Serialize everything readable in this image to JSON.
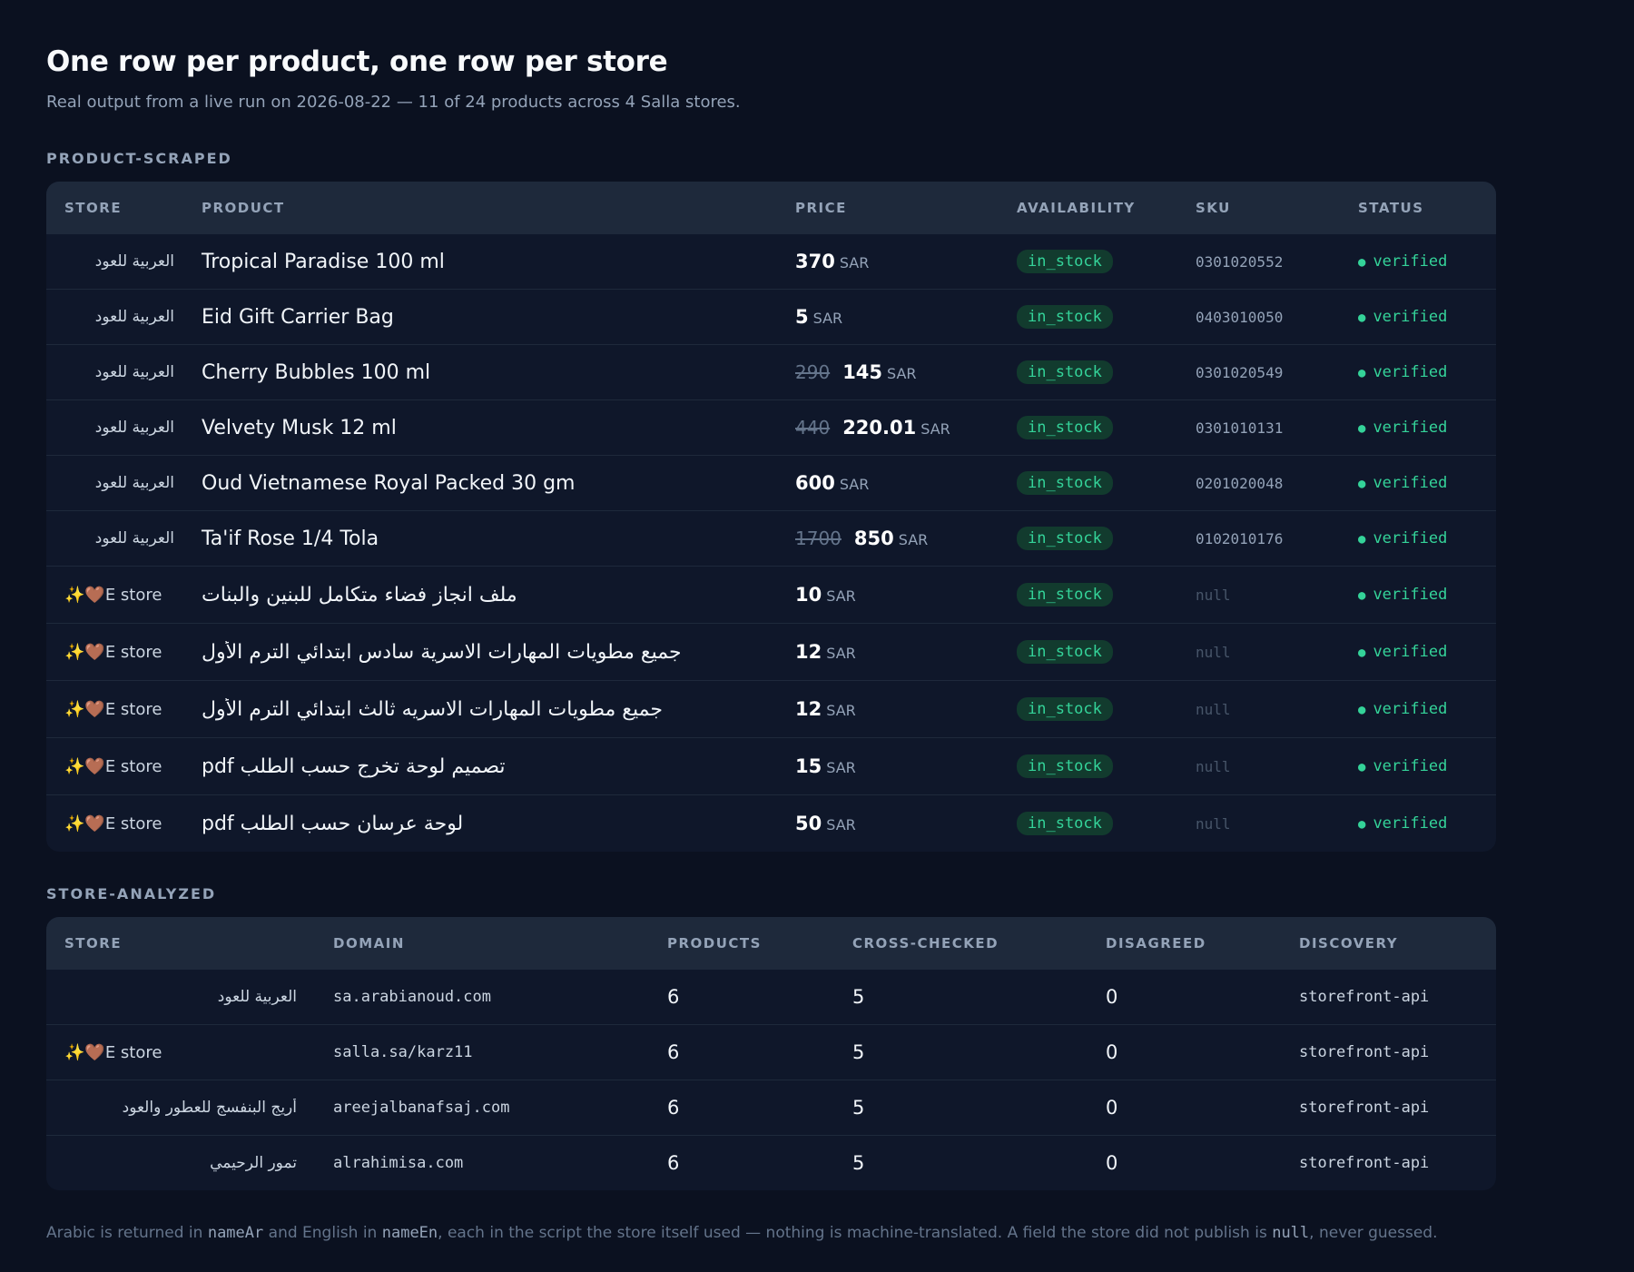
{
  "header": {
    "title": "One row per product, one row per store",
    "subtitle": "Real output from a live run on 2026-08-22 — 11 of 24 products across 4 Salla stores."
  },
  "product_section": {
    "label": "PRODUCT-SCRAPED",
    "columns": [
      "STORE",
      "PRODUCT",
      "PRICE",
      "AVAILABILITY",
      "SKU",
      "STATUS"
    ],
    "currency": "SAR",
    "rows": [
      {
        "store": "العربية للعود",
        "product": "Tropical Paradise 100 ml",
        "old_price": "",
        "price": "370",
        "availability": "in_stock",
        "sku": "0301020552",
        "status": "verified"
      },
      {
        "store": "العربية للعود",
        "product": "Eid Gift Carrier Bag",
        "old_price": "",
        "price": "5",
        "availability": "in_stock",
        "sku": "0403010050",
        "status": "verified"
      },
      {
        "store": "العربية للعود",
        "product": "Cherry Bubbles 100 ml",
        "old_price": "290",
        "price": "145",
        "availability": "in_stock",
        "sku": "0301020549",
        "status": "verified"
      },
      {
        "store": "العربية للعود",
        "product": "Velvety Musk 12 ml",
        "old_price": "440",
        "price": "220.01",
        "availability": "in_stock",
        "sku": "0301010131",
        "status": "verified"
      },
      {
        "store": "العربية للعود",
        "product": "Oud Vietnamese Royal Packed 30 gm",
        "old_price": "",
        "price": "600",
        "availability": "in_stock",
        "sku": "0201020048",
        "status": "verified"
      },
      {
        "store": "العربية للعود",
        "product": "Ta'if Rose 1/4 Tola",
        "old_price": "1700",
        "price": "850",
        "availability": "in_stock",
        "sku": "0102010176",
        "status": "verified"
      },
      {
        "store": "✨🤎E store",
        "product": "ملف انجاز فضاء متكامل للبنين والبنات",
        "old_price": "",
        "price": "10",
        "availability": "in_stock",
        "sku": "null",
        "status": "verified"
      },
      {
        "store": "✨🤎E store",
        "product": "جميع مطويات المهارات الاسرية سادس ابتدائي الترم الأول",
        "old_price": "",
        "price": "12",
        "availability": "in_stock",
        "sku": "null",
        "status": "verified"
      },
      {
        "store": "✨🤎E store",
        "product": "جميع مطويات المهارات الاسريه ثالث ابتدائي الترم الأول",
        "old_price": "",
        "price": "12",
        "availability": "in_stock",
        "sku": "null",
        "status": "verified"
      },
      {
        "store": "✨🤎E store",
        "product": "تصميم لوحة تخرج حسب الطلب pdf",
        "old_price": "",
        "price": "15",
        "availability": "in_stock",
        "sku": "null",
        "status": "verified"
      },
      {
        "store": "✨🤎E store",
        "product": "لوحة عرسان حسب الطلب pdf",
        "old_price": "",
        "price": "50",
        "availability": "in_stock",
        "sku": "null",
        "status": "verified"
      }
    ]
  },
  "store_section": {
    "label": "STORE-ANALYZED",
    "columns": [
      "STORE",
      "DOMAIN",
      "PRODUCTS",
      "CROSS-CHECKED",
      "DISAGREED",
      "DISCOVERY"
    ],
    "rows": [
      {
        "store": "العربية للعود",
        "domain": "sa.arabianoud.com",
        "products": "6",
        "cross_checked": "5",
        "disagreed": "0",
        "discovery": "storefront-api"
      },
      {
        "store": "✨🤎E store",
        "domain": "salla.sa/karz11",
        "products": "6",
        "cross_checked": "5",
        "disagreed": "0",
        "discovery": "storefront-api"
      },
      {
        "store": "أريج البنفسج للعطور والعود",
        "domain": "areejalbanafsaj.com",
        "products": "6",
        "cross_checked": "5",
        "disagreed": "0",
        "discovery": "storefront-api"
      },
      {
        "store": "تمور الرحيمي",
        "domain": "alrahimisa.com",
        "products": "6",
        "cross_checked": "5",
        "disagreed": "0",
        "discovery": "storefront-api"
      }
    ]
  },
  "footer": {
    "part1": "Arabic is returned in ",
    "code1": "nameAr",
    "part2": " and English in ",
    "code2": "nameEn",
    "part3": ", each in the script the store itself used — nothing is machine-translated. A field the store did not publish is ",
    "code3": "null",
    "part4": ", never guessed."
  },
  "colors": {
    "background": "#0b1120",
    "card": "#0f172a",
    "header_row": "#1e293b",
    "accent_green": "#34d399"
  }
}
